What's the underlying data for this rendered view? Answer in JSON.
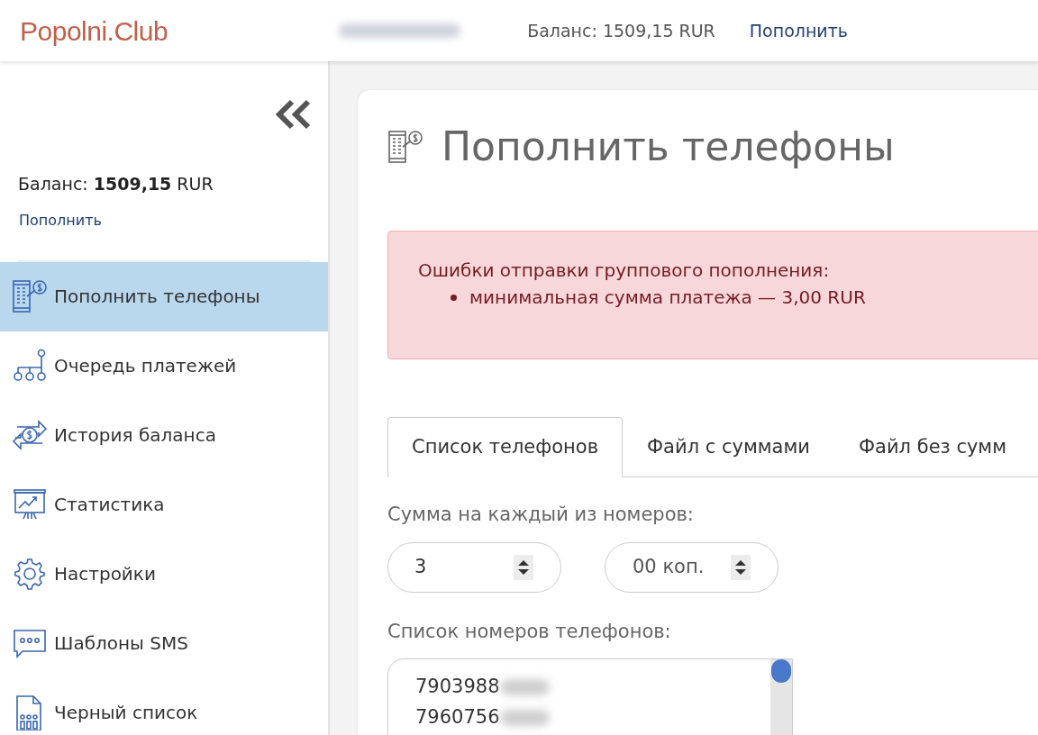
{
  "header": {
    "logo": "Popolni.Club",
    "balance": "Баланс: 1509,15 RUR",
    "topup_link": "Пополнить"
  },
  "sidebar": {
    "balance": "Баланс: **1509,15** RUR",
    "topup_link": "Пополнить",
    "items": [
      {
        "label": "Пополнить телефоны",
        "selected": true
      },
      {
        "label": "Очередь платежей",
        "selected": false
      },
      {
        "label": "История баланса",
        "selected": false
      },
      {
        "label": "Статистика",
        "selected": false
      },
      {
        "label": "Настройки",
        "selected": false
      },
      {
        "label": "Шаблоны SMS",
        "selected": false
      },
      {
        "label": "Черный список",
        "selected": false
      }
    ]
  },
  "page": {
    "title": "Пополнить телефоны",
    "alert": {
      "title": "Ошибки отправки группового пополнения:",
      "items": [
        "минимальная сумма платежа — 3,00 RUR"
      ]
    },
    "tabs": [
      {
        "label": "Список телефонов",
        "selected": true
      },
      {
        "label": "Файл с суммами",
        "selected": false
      },
      {
        "label": "Файл без сумм",
        "selected": false
      }
    ],
    "amount_label": "Сумма на каждый из номеров:",
    "rubles": "3",
    "kopecks": "00 коп.",
    "phones_label": "Список номеров телефонов:",
    "phones": [
      "7903988",
      "7960756"
    ]
  }
}
